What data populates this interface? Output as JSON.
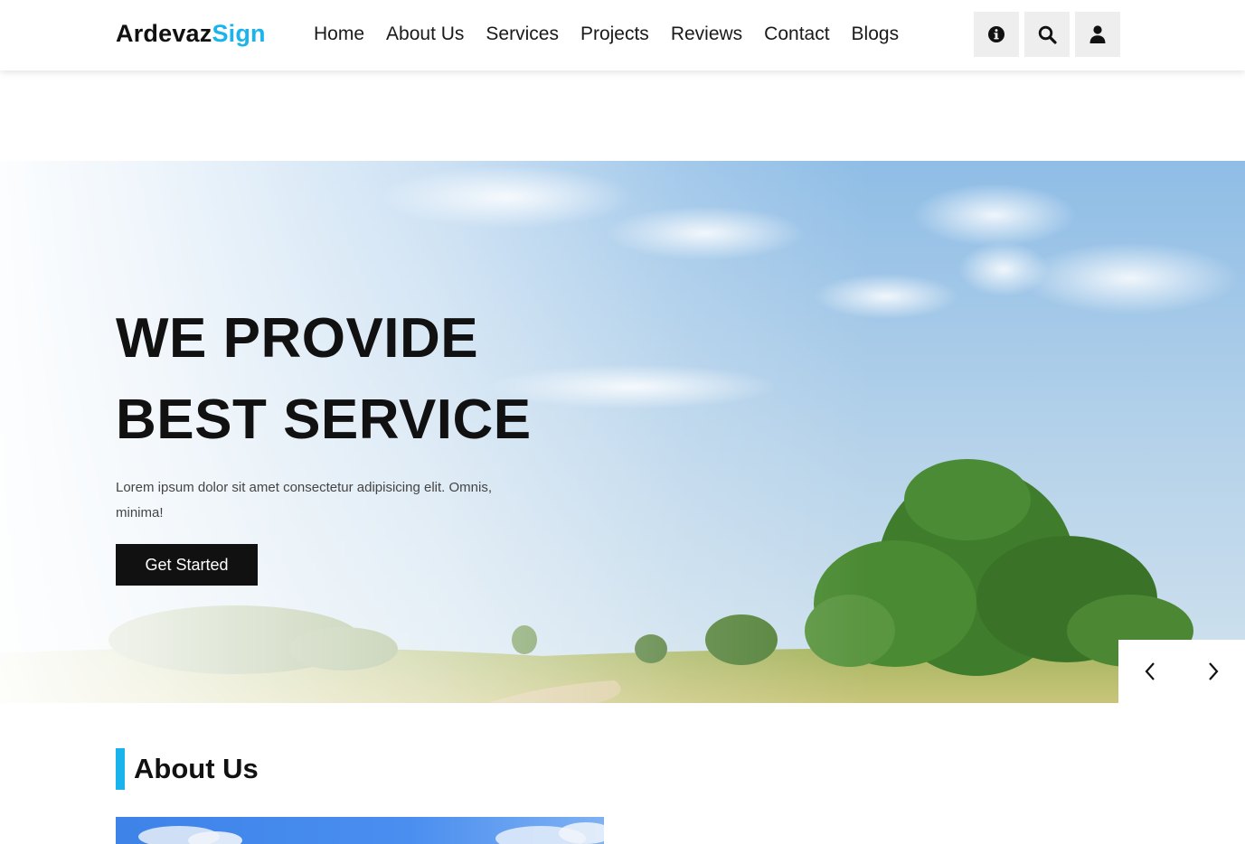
{
  "brand": {
    "name_part1": "Ardevaz",
    "name_part2": "Sign",
    "accent_color": "#1ab3ec"
  },
  "nav": {
    "items": [
      {
        "label": "Home"
      },
      {
        "label": "About Us"
      },
      {
        "label": "Services"
      },
      {
        "label": "Projects"
      },
      {
        "label": "Reviews"
      },
      {
        "label": "Contact"
      },
      {
        "label": "Blogs"
      }
    ],
    "icons": [
      "info-icon",
      "search-icon",
      "user-icon"
    ]
  },
  "hero": {
    "title_line1": "WE PROVIDE",
    "title_line2": "BEST SERVICE",
    "description": "Lorem ipsum dolor sit amet consectetur adipisicing elit. Omnis, minima!",
    "cta_label": "Get Started",
    "prev_icon": "chevron-left-icon",
    "next_icon": "chevron-right-icon"
  },
  "about": {
    "heading": "About Us"
  }
}
